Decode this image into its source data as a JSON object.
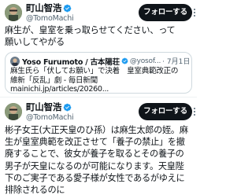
{
  "tweets": [
    {
      "display_name": "町山智浩",
      "handle": "@TomoMachi",
      "follow_label": "フォローする",
      "text": "麻生が、皇室を乗っ取らせてください、って\n願いしてやがる",
      "quote": {
        "display_name": "Yoso Furumoto / 古本陽荘",
        "handle": "@yosof...",
        "date": "· 7月1日",
        "text": "麻生氏ら「伏してお願い」で決着　皇室典範改正の\n維新「反乱」劇 - 毎日新聞\nmainichi.jp/articles/20260..."
      }
    },
    {
      "display_name": "町山智浩",
      "handle": "@TomoMachi",
      "follow_label": "フォローする",
      "text": "彬子女王(大正天皇のひ孫）は麻生太郎の姪。麻\n生が皇室典範を改正させて「養子の禁止」を撤\n廃することで、彼女が養子を取るとその養子の\n男子が天皇になるのが可能になります。天皇陛\n下のご実子である愛子様が女性であるがゆえに\n排除されるのに"
    }
  ],
  "colors": {
    "follow_bg": "#0f1419",
    "verified": "#1d9bf0",
    "secondary_text": "#536471"
  },
  "icons": {
    "verified": "verified-badge-icon",
    "more": "more-options-icon"
  }
}
